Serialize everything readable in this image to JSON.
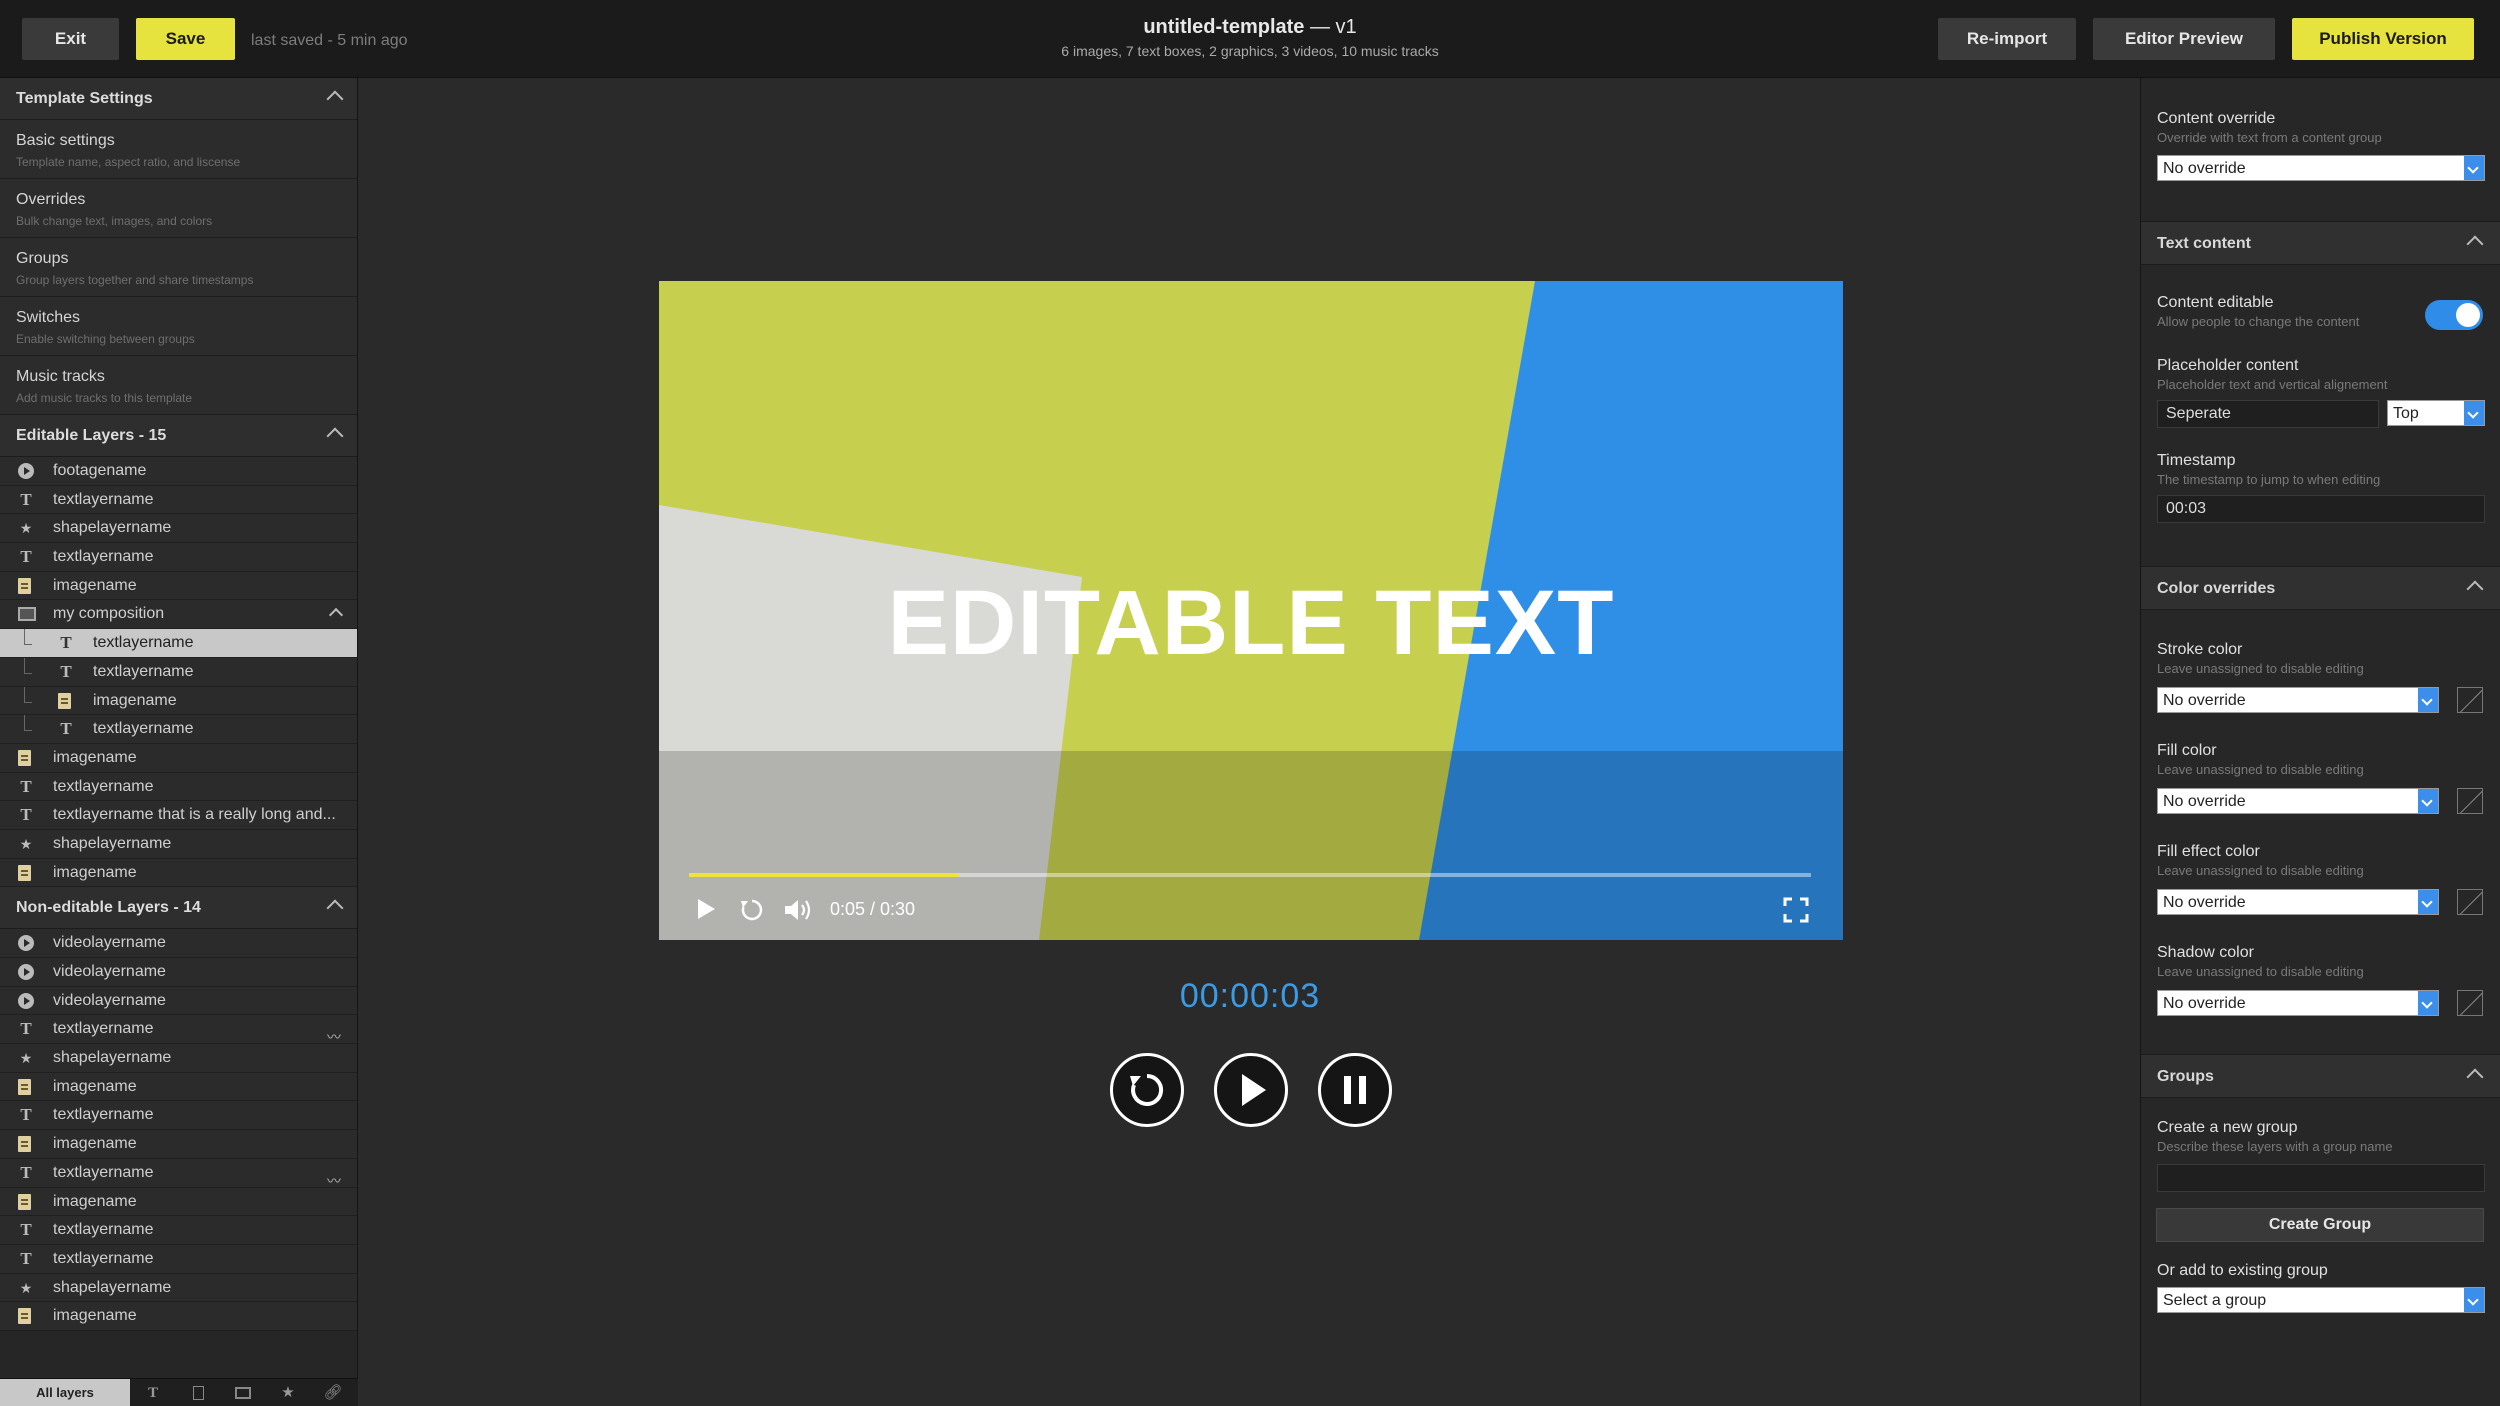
{
  "topbar": {
    "exit_label": "Exit",
    "save_label": "Save",
    "saved_text": "last saved - 5 min ago",
    "title": "untitled-template",
    "version": " — v1",
    "subtitle": "6 images, 7 text boxes, 2 graphics, 3 videos, 10 music tracks",
    "reimport_label": "Re-import",
    "editor_preview_label": "Editor Preview",
    "publish_label": "Publish Version"
  },
  "left": {
    "template_settings_title": "Template Settings",
    "settings": [
      {
        "title": "Basic settings",
        "desc": "Template name, aspect ratio, and liscense"
      },
      {
        "title": "Overrides",
        "desc": "Bulk change text, images, and colors"
      },
      {
        "title": "Groups",
        "desc": "Group layers together and share timestamps"
      },
      {
        "title": "Switches",
        "desc": "Enable switching between groups"
      },
      {
        "title": "Music tracks",
        "desc": "Add music tracks to this template"
      }
    ],
    "editable_title": "Editable Layers - 15",
    "editable_layers": [
      {
        "icon": "video-icon",
        "name": "footagename"
      },
      {
        "icon": "text-icon",
        "name": "textlayername"
      },
      {
        "icon": "star-icon",
        "name": "shapelayername"
      },
      {
        "icon": "text-icon",
        "name": "textlayername"
      },
      {
        "icon": "image-icon",
        "name": "imagename"
      },
      {
        "icon": "composition-icon",
        "name": "my composition"
      },
      {
        "icon": "text-icon",
        "name": "textlayername"
      },
      {
        "icon": "text-icon",
        "name": "textlayername"
      },
      {
        "icon": "image-icon",
        "name": "imagename"
      },
      {
        "icon": "text-icon",
        "name": "textlayername"
      },
      {
        "icon": "image-icon",
        "name": "imagename"
      },
      {
        "icon": "text-icon",
        "name": "textlayername"
      },
      {
        "icon": "text-icon",
        "name": "textlayername that is a really long and..."
      },
      {
        "icon": "star-icon",
        "name": "shapelayername"
      },
      {
        "icon": "image-icon",
        "name": "imagename"
      }
    ],
    "noneditable_title": "Non-editable Layers - 14",
    "noneditable_layers": [
      {
        "icon": "video-icon",
        "name": "videolayername"
      },
      {
        "icon": "video-icon",
        "name": "videolayername"
      },
      {
        "icon": "video-icon",
        "name": "videolayername"
      },
      {
        "icon": "text-icon",
        "name": "textlayername"
      },
      {
        "icon": "star-icon",
        "name": "shapelayername"
      },
      {
        "icon": "image-icon",
        "name": "imagename"
      },
      {
        "icon": "text-icon",
        "name": "textlayername"
      },
      {
        "icon": "image-icon",
        "name": "imagename"
      },
      {
        "icon": "text-icon",
        "name": "textlayername"
      },
      {
        "icon": "image-icon",
        "name": "imagename"
      },
      {
        "icon": "text-icon",
        "name": "textlayername"
      },
      {
        "icon": "text-icon",
        "name": "textlayername"
      },
      {
        "icon": "star-icon",
        "name": "shapelayername"
      },
      {
        "icon": "image-icon",
        "name": "imagename"
      }
    ],
    "tabs": {
      "all": "All layers"
    }
  },
  "preview": {
    "overlay_text": "EDITABLE TEXT",
    "time": "0:05 / 0:30",
    "progress": 0.24,
    "timecode": "00:00:03"
  },
  "right": {
    "content_override": {
      "label": "Content override",
      "desc": "Override with text from a content group",
      "value": "No override"
    },
    "text_content_title": "Text content",
    "content_editable": {
      "label": "Content editable",
      "desc": "Allow people to change the content",
      "on": true
    },
    "placeholder": {
      "label": "Placeholder content",
      "desc": "Placeholder text and vertical alignement",
      "value": "Seperate",
      "align": "Top"
    },
    "timestamp": {
      "label": "Timestamp",
      "desc": "The timestamp to jump to when editing",
      "value": "00:03"
    },
    "color_overrides_title": "Color overrides",
    "colors": [
      {
        "label": "Stroke color",
        "desc": "Leave unassigned to disable editing",
        "value": "No override"
      },
      {
        "label": "Fill color",
        "desc": "Leave unassigned to disable editing",
        "value": "No override"
      },
      {
        "label": "Fill effect color",
        "desc": "Leave unassigned to disable editing",
        "value": "No override"
      },
      {
        "label": "Shadow color",
        "desc": "Leave unassigned to disable editing",
        "value": "No override"
      }
    ],
    "groups_title": "Groups",
    "create_group": {
      "label": "Create a new group",
      "desc": "Describe these layers with a group name",
      "button": "Create Group"
    },
    "existing_group": {
      "label": "Or add to existing group",
      "value": "Select a group"
    }
  }
}
